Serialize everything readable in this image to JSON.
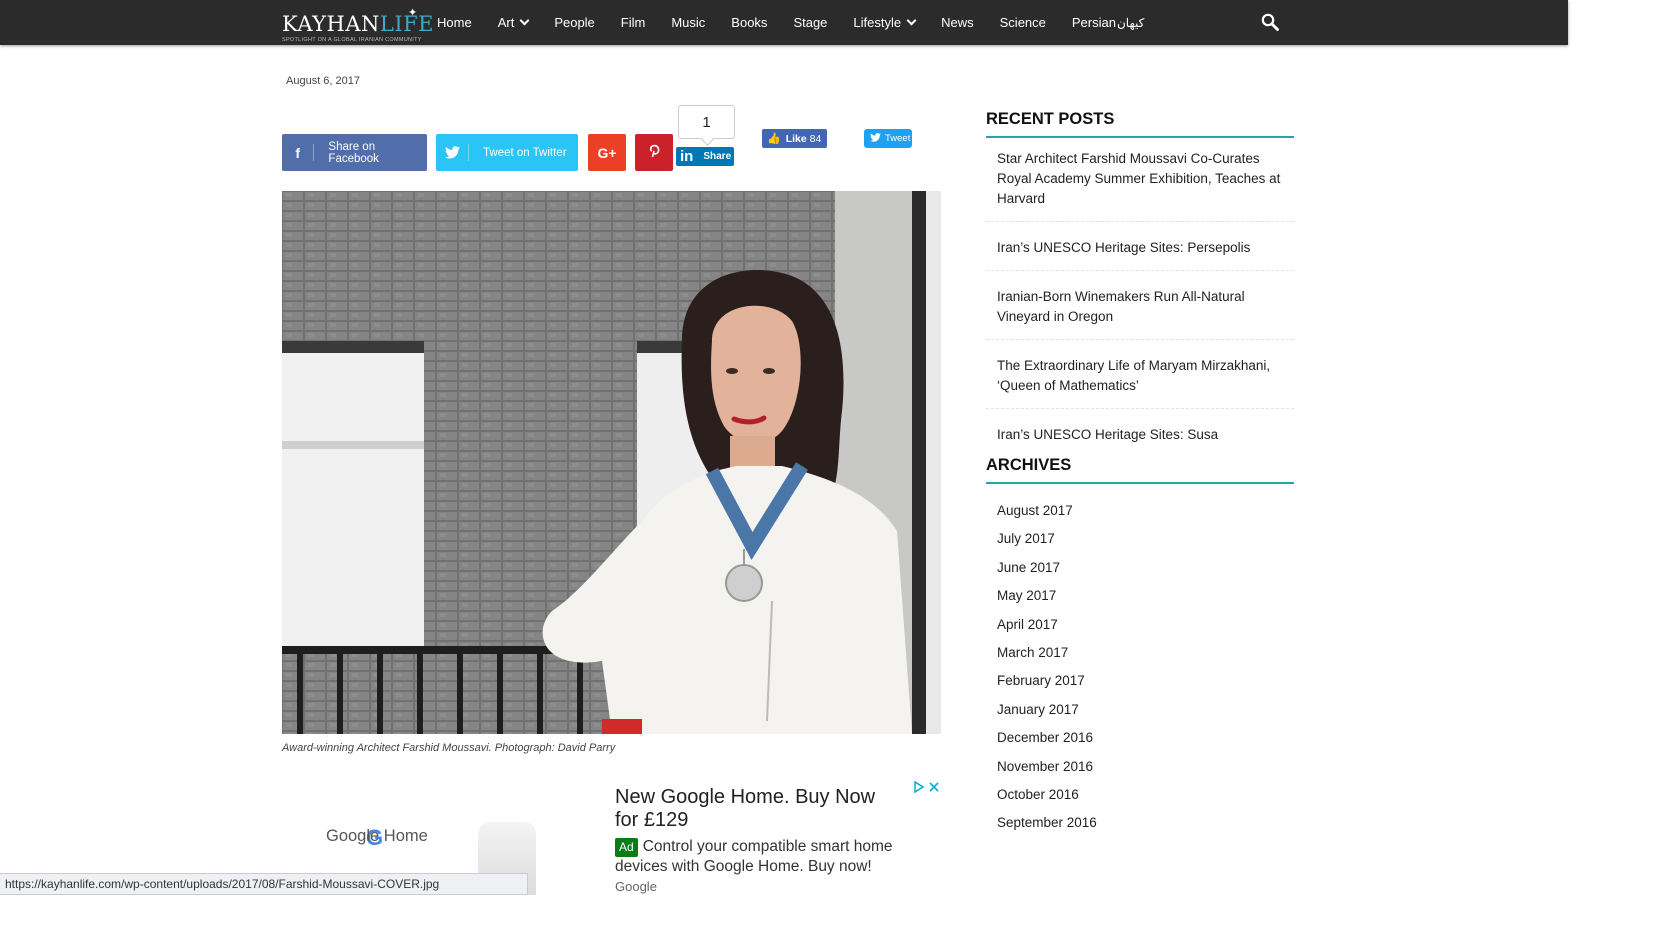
{
  "header": {
    "logo": {
      "brand_main": "KAYHAN",
      "brand_accent": "LIFE",
      "tagline": "SPOTLIGHT ON A GLOBAL IRANIAN COMMUNITY"
    },
    "nav": [
      {
        "label": "Home",
        "dropdown": false
      },
      {
        "label": "Art",
        "dropdown": true
      },
      {
        "label": "People",
        "dropdown": false
      },
      {
        "label": "Film",
        "dropdown": false
      },
      {
        "label": "Music",
        "dropdown": false
      },
      {
        "label": "Books",
        "dropdown": false
      },
      {
        "label": "Stage",
        "dropdown": false
      },
      {
        "label": "Lifestyle",
        "dropdown": true
      },
      {
        "label": "News",
        "dropdown": false
      },
      {
        "label": "Science",
        "dropdown": false
      },
      {
        "label": "Persian",
        "dropdown": false,
        "suffix": "کیهان"
      }
    ]
  },
  "article": {
    "date": "August 6, 2017",
    "share": {
      "facebook_label": "Share on Facebook",
      "twitter_label": "Tweet on Twitter",
      "googleplus_label": "G+",
      "linkedin_count": "1",
      "linkedin_label": "Share",
      "fb_like_label": "Like",
      "fb_like_count": "84",
      "tweet_label": "Tweet"
    },
    "caption": "Award-winning Architect Farshid Moussavi. Photograph: David Parry"
  },
  "ad": {
    "title": "New Google Home. Buy Now for £129",
    "badge": "Ad",
    "description": "Control your compatible smart home devices with Google Home. Buy now!",
    "source": "Google",
    "product_label": "Google Home",
    "product_logo": "G"
  },
  "sidebar": {
    "recent_title": "RECENT POSTS",
    "recent_posts": [
      "Star Architect Farshid Moussavi Co-Curates Royal Academy Summer Exhibition, Teaches at Harvard",
      "Iran’s UNESCO Heritage Sites: Persepolis",
      "Iranian-Born Winemakers Run All-Natural Vineyard in Oregon",
      "The Extraordinary Life of Maryam Mirzakhani, ‘Queen of Mathematics’",
      "Iran’s UNESCO Heritage Sites: Susa"
    ],
    "archives_title": "ARCHIVES",
    "archives": [
      "August 2017",
      "July 2017",
      "June 2017",
      "May 2017",
      "April 2017",
      "March 2017",
      "February 2017",
      "January 2017",
      "December 2016",
      "November 2016",
      "October 2016",
      "September 2016"
    ]
  },
  "status_bar": {
    "url": "https://kayhanlife.com/wp-content/uploads/2017/08/Farshid-Moussavi-COVER.jpg"
  },
  "colors": {
    "topbar": "#2b2b2b",
    "accent_teal": "#25a5a5",
    "facebook": "#516eab",
    "twitter": "#29c5f6",
    "googleplus": "#eb4026",
    "pinterest": "#ca212a",
    "linkedin": "#0077b5"
  },
  "icons": [
    "search-icon",
    "facebook-icon",
    "twitter-icon",
    "google-plus-icon",
    "pinterest-icon",
    "linkedin-icon",
    "thumbs-up-icon",
    "twitter-bird-icon",
    "adchoices-icon",
    "close-icon"
  ]
}
